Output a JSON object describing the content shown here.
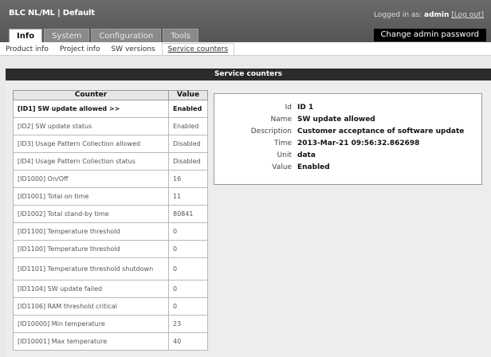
{
  "header": {
    "app_title": "BLC NL/ML | Default",
    "login_prefix": "Logged in as:",
    "login_user": "admin",
    "logout_label": "[Log out]",
    "change_password_label": "Change admin password"
  },
  "tabs": [
    {
      "label": "Info",
      "active": true
    },
    {
      "label": "System",
      "active": false
    },
    {
      "label": "Configuration",
      "active": false
    },
    {
      "label": "Tools",
      "active": false
    }
  ],
  "subnav": [
    {
      "label": "Product info",
      "active": false
    },
    {
      "label": "Project info",
      "active": false
    },
    {
      "label": "SW versions",
      "active": false
    },
    {
      "label": "Service counters",
      "active": true
    }
  ],
  "section_title": "Service counters",
  "table": {
    "headers": {
      "counter": "Counter",
      "value": "Value"
    },
    "rows": [
      {
        "counter": "[ID1] SW update allowed >>",
        "value": "Enabled",
        "selected": true
      },
      {
        "counter": "[ID2] SW update status",
        "value": "Enabled"
      },
      {
        "counter": "[ID3] Usage Pattern Collection allowed",
        "value": "Disabled"
      },
      {
        "counter": "[ID4] Usage Pattern Collection status",
        "value": "Disabled"
      },
      {
        "counter": "[ID1000] On/Off",
        "value": "16"
      },
      {
        "counter": "[ID1001] Total on time",
        "value": "11"
      },
      {
        "counter": "[ID1002] Total stand-by time",
        "value": "80841"
      },
      {
        "counter": "[ID1100] Temperature threshold",
        "value": "0"
      },
      {
        "counter": "[ID1100] Temperature threshold",
        "value": "0"
      },
      {
        "counter": "[ID1101] Temperature threshold shutdown",
        "value": "0",
        "tall": true
      },
      {
        "counter": "[ID1104] SW update failed",
        "value": "0"
      },
      {
        "counter": "[ID1106] RAM threshold critical",
        "value": "0"
      },
      {
        "counter": "[ID10000] Min temperature",
        "value": "23"
      },
      {
        "counter": "[ID10001] Max temperature",
        "value": "40"
      }
    ]
  },
  "detail": [
    {
      "key": "Id",
      "value": "ID 1"
    },
    {
      "key": "Name",
      "value": "SW update allowed"
    },
    {
      "key": "Description",
      "value": "Customer acceptance of software update"
    },
    {
      "key": "Time",
      "value": "2013-Mar-21 09:56:32.862698"
    },
    {
      "key": "Unit",
      "value": "data"
    },
    {
      "key": "Value",
      "value": "Enabled"
    }
  ]
}
